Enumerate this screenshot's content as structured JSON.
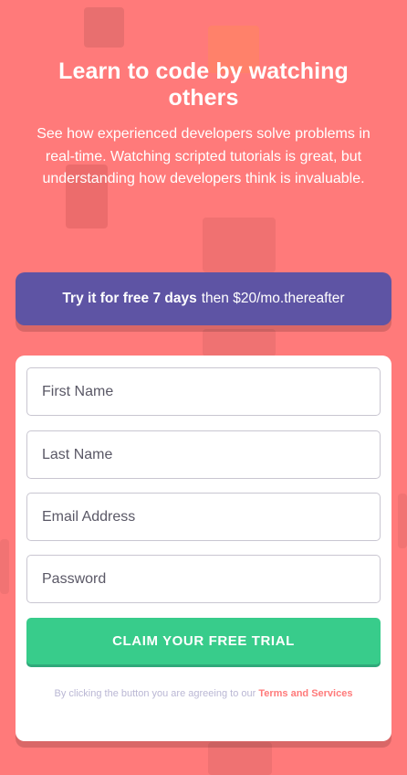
{
  "hero": {
    "title": "Learn to code by watching others",
    "description": "See how experienced developers solve problems in real-time. Watching scripted tutorials is great, but understanding how developers think is invaluable."
  },
  "promo": {
    "bold": "Try it for free 7 days",
    "rest": "then $20/mo.thereafter"
  },
  "form": {
    "first_name_placeholder": "First Name",
    "last_name_placeholder": "Last Name",
    "email_placeholder": "Email Address",
    "password_placeholder": "Password",
    "submit_label": "Claim your free trial",
    "terms_prefix": "By clicking the button you are agreeing to our",
    "terms_link": "Terms and Services"
  },
  "colors": {
    "background": "#ff7a7a",
    "promo": "#5e54a4",
    "cta": "#38cc8b"
  }
}
